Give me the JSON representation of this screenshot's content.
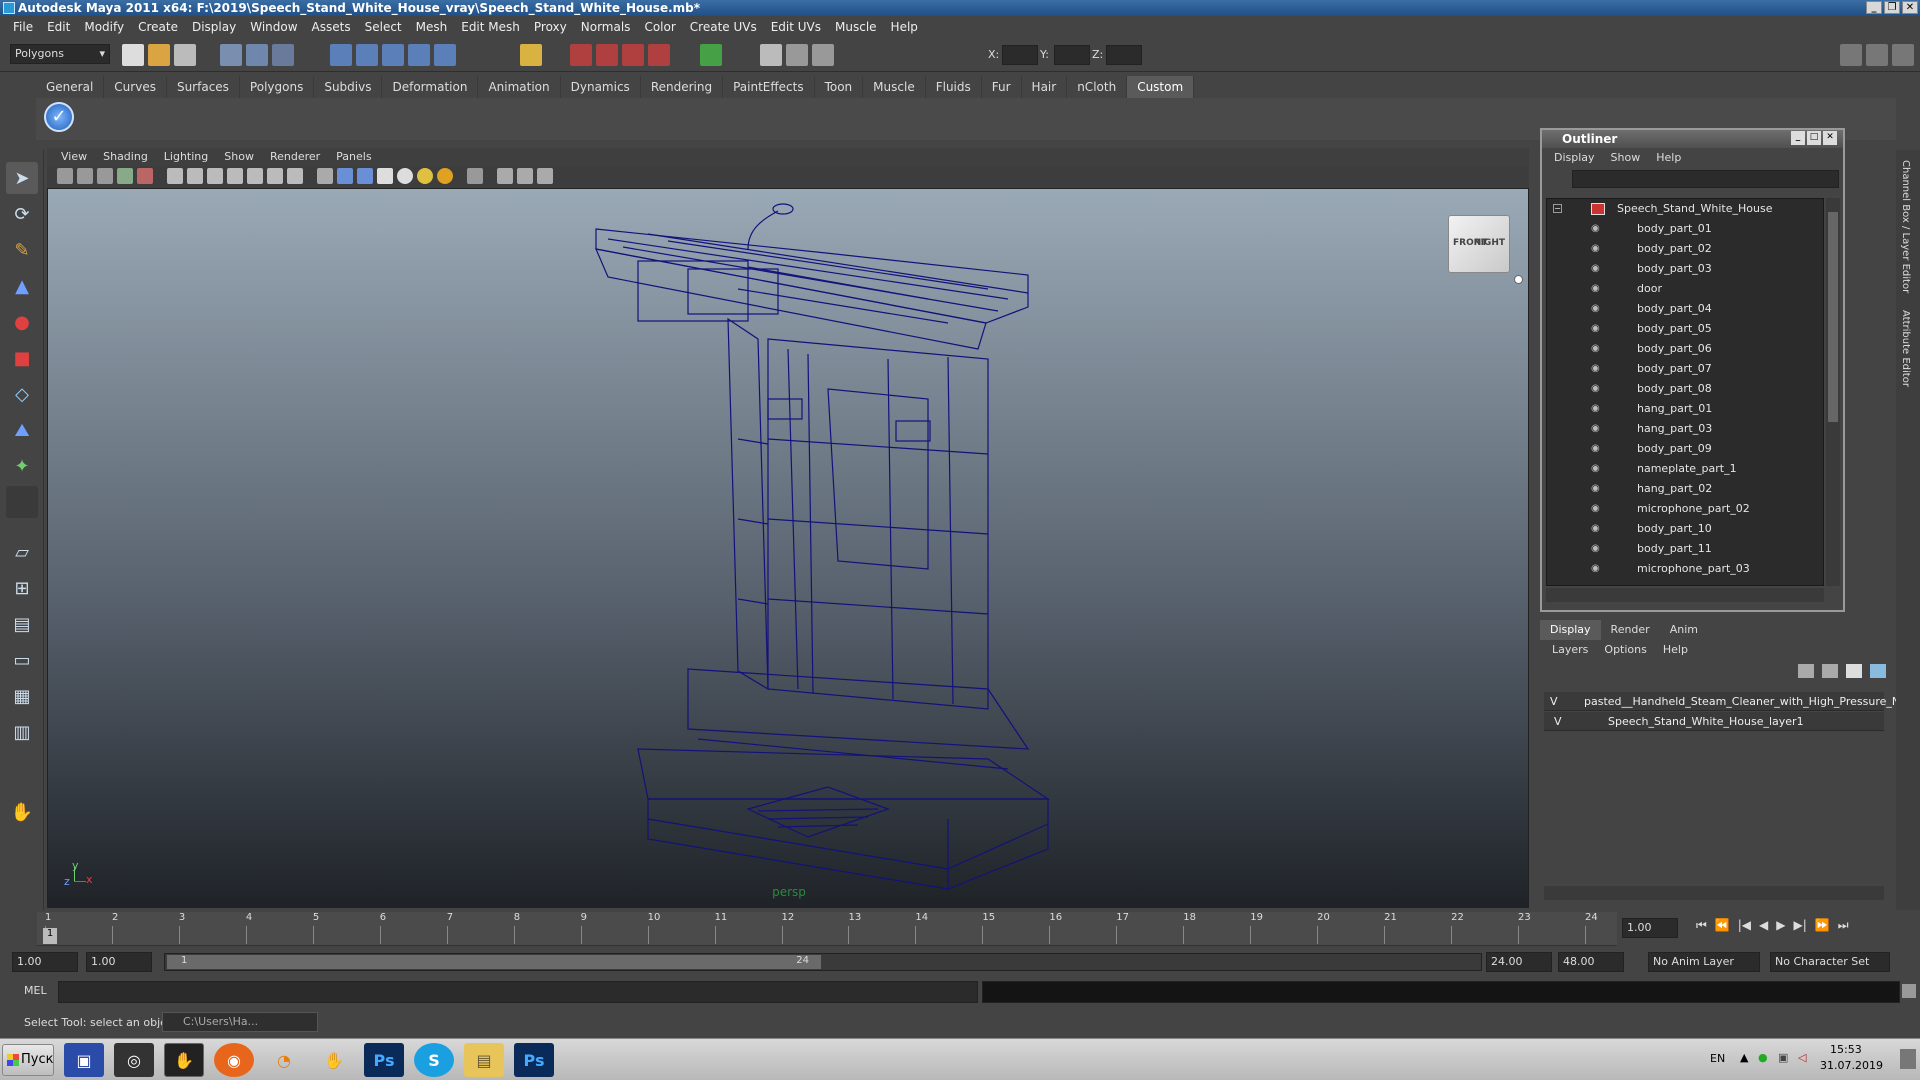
{
  "window": {
    "title": "Autodesk Maya 2011 x64: F:\\2019\\Speech_Stand_White_House_vray\\Speech_Stand_White_House.mb*"
  },
  "menubar": [
    "File",
    "Edit",
    "Modify",
    "Create",
    "Display",
    "Window",
    "Assets",
    "Select",
    "Mesh",
    "Edit Mesh",
    "Proxy",
    "Normals",
    "Color",
    "Create UVs",
    "Edit UVs",
    "Muscle",
    "Help"
  ],
  "statusline": {
    "menuset": "Polygons",
    "x_label": "X:",
    "y_label": "Y:",
    "z_label": "Z:"
  },
  "shelf_tabs": [
    "General",
    "Curves",
    "Surfaces",
    "Polygons",
    "Subdivs",
    "Deformation",
    "Animation",
    "Dynamics",
    "Rendering",
    "PaintEffects",
    "Toon",
    "Muscle",
    "Fluids",
    "Fur",
    "Hair",
    "nCloth",
    "Custom"
  ],
  "shelf_active": "Custom",
  "panel_menu": [
    "View",
    "Shading",
    "Lighting",
    "Show",
    "Renderer",
    "Panels"
  ],
  "viewport": {
    "camera": "persp",
    "viewcube_front": "FRONT",
    "viewcube_right": "RIGHT",
    "axis_x": "x",
    "axis_y": "y",
    "axis_z": "z",
    "wire_color": "#12127a"
  },
  "outliner": {
    "title": "Outliner",
    "menu": [
      "Display",
      "Show",
      "Help"
    ],
    "root": "Speech_Stand_White_House",
    "items": [
      "body_part_01",
      "body_part_02",
      "body_part_03",
      "door",
      "body_part_04",
      "body_part_05",
      "body_part_06",
      "body_part_07",
      "body_part_08",
      "hang_part_01",
      "hang_part_03",
      "body_part_09",
      "nameplate_part_1",
      "hang_part_02",
      "microphone_part_02",
      "body_part_10",
      "body_part_11",
      "microphone_part_03"
    ]
  },
  "layers": {
    "tabs": [
      "Display",
      "Render",
      "Anim"
    ],
    "active_tab": "Display",
    "menu": [
      "Layers",
      "Options",
      "Help"
    ],
    "rows": [
      {
        "v": "V",
        "name": "pasted__Handheld_Steam_Cleaner_with_High_Pressure_Nozz"
      },
      {
        "v": "V",
        "name": "Speech_Stand_White_House_layer1"
      }
    ]
  },
  "side_tabs": [
    "Channel Box / Layer Editor",
    "Attribute Editor"
  ],
  "timeline": {
    "ticks": [
      "1",
      "2",
      "3",
      "4",
      "5",
      "6",
      "7",
      "8",
      "9",
      "10",
      "11",
      "12",
      "13",
      "14",
      "15",
      "16",
      "17",
      "18",
      "19",
      "20",
      "21",
      "22",
      "23",
      "24"
    ],
    "current_frame_field": "1.00",
    "current_marker": "1"
  },
  "range": {
    "start": "1.00",
    "anim_start": "1.00",
    "range_start_label": "1",
    "range_end_label": "24",
    "anim_end": "24.00",
    "end": "48.00",
    "anim_layer": "No Anim Layer",
    "character_set": "No Character Set"
  },
  "cmdline": {
    "label": "MEL"
  },
  "helpline": {
    "text": "Select Tool: select an object",
    "mini_window": "C:\\Users\\Ha..."
  },
  "taskbar": {
    "start": "Пуск",
    "lang": "EN",
    "time": "15:53",
    "date": "31.07.2019",
    "apps": [
      "save",
      "maya",
      "ps-gear",
      "firefox",
      "blender",
      "tool",
      "Ps",
      "skype",
      "folder",
      "Ps"
    ]
  }
}
